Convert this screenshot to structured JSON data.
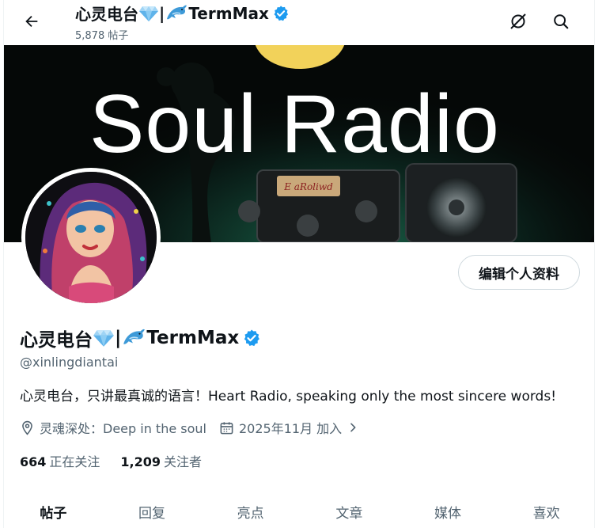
{
  "header": {
    "name_prefix": "心灵电台",
    "separator": "|",
    "name_suffix": "TermMax",
    "post_count": "5,878 帖子",
    "icons": {
      "back": "arrow-left-icon",
      "grok": "slash-circle-icon",
      "search": "search-icon"
    }
  },
  "banner": {
    "title": "Soul Radio",
    "radio_label": "E aRoliwd",
    "colors": {
      "background": "#050807",
      "moon": "#f2d25a",
      "glow": "#1f7a5a"
    }
  },
  "profile": {
    "edit_button": "编辑个人资料",
    "name_prefix": "心灵电台",
    "separator": "|",
    "name_suffix": "TermMax",
    "handle": "@xinlingdiantai",
    "bio": "心灵电台，只讲最真诚的语言！Heart Radio, speaking only the most sincere words!",
    "location": "灵魂深处：Deep in the soul",
    "joined": "2025年11月 加入",
    "following_count": "664",
    "following_label": "正在关注",
    "followers_count": "1,209",
    "followers_label": "关注者",
    "verified_color": "#1d9bf0"
  },
  "tabs": [
    {
      "label": "帖子",
      "active": true
    },
    {
      "label": "回复",
      "active": false
    },
    {
      "label": "亮点",
      "active": false
    },
    {
      "label": "文章",
      "active": false
    },
    {
      "label": "媒体",
      "active": false
    },
    {
      "label": "喜欢",
      "active": false
    }
  ]
}
